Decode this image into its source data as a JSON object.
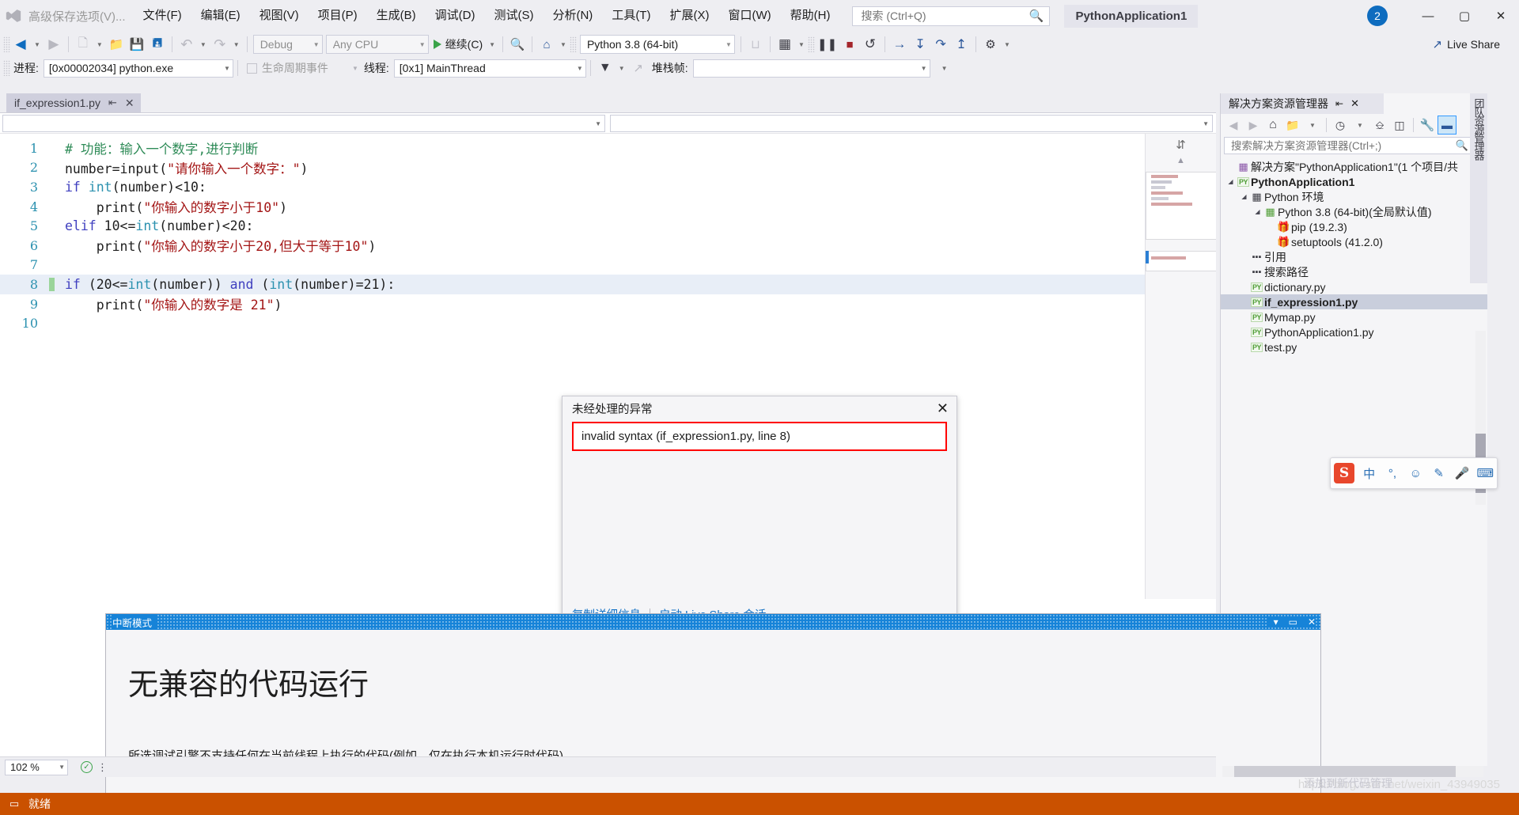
{
  "titlebar": {
    "quick_access_label": "高级保存选项(V)...",
    "menus": [
      {
        "label": "文件(F)"
      },
      {
        "label": "编辑(E)"
      },
      {
        "label": "视图(V)"
      },
      {
        "label": "项目(P)"
      },
      {
        "label": "生成(B)"
      },
      {
        "label": "调试(D)"
      },
      {
        "label": "测试(S)"
      },
      {
        "label": "分析(N)"
      },
      {
        "label": "工具(T)"
      },
      {
        "label": "扩展(X)"
      },
      {
        "label": "窗口(W)"
      },
      {
        "label": "帮助(H)"
      }
    ],
    "search_placeholder": "搜索 (Ctrl+Q)",
    "project_title": "PythonApplication1",
    "notification_count": "2",
    "window_minimize": "—",
    "window_maximize": "▢",
    "window_close": "✕"
  },
  "toolbar": {
    "back_label": "◀",
    "forward_label": "▶",
    "new_label": "▤",
    "open_label": "📂",
    "save_label": "💾",
    "save_all_label": "🖫",
    "undo_label": "↶",
    "redo_label": "↷",
    "config_value": "Debug",
    "platform_value": "Any CPU",
    "continue_label": "继续(C)",
    "attach_label": "🔍",
    "home_label": "⌂",
    "interpreter_value": "Python 3.8 (64-bit)",
    "layout_label": "▤",
    "pause_label": "❚❚",
    "stop_label": "■",
    "restart_label": "↺",
    "show_next_label": "→",
    "step_into_label": "↓",
    "step_over_label": "↷",
    "step_out_label": "↑",
    "hotreload_label": "⚡",
    "live_share_label": "Live Share"
  },
  "debugbar": {
    "process_label": "进程:",
    "process_value": "[0x00002034] python.exe",
    "lifecycle_label": "生命周期事件",
    "thread_label": "线程:",
    "thread_value": "[0x1] MainThread",
    "stack_label": "堆栈帧:",
    "stack_value": ""
  },
  "editor": {
    "tab_label": "if_expression1.py",
    "tab_pin": "⇤",
    "tab_close": "✕",
    "lines": [
      {
        "num": "1",
        "bp": false,
        "current": false,
        "tokens": [
          {
            "t": "# 功能：输入一个数字,进行判断",
            "c": "tok-com"
          }
        ]
      },
      {
        "num": "2",
        "bp": false,
        "current": false,
        "tokens": [
          {
            "t": "number=input(",
            "c": "tok-pl"
          },
          {
            "t": "\"请你输入一个数字：\"",
            "c": "tok-str"
          },
          {
            "t": ")",
            "c": "tok-pl"
          }
        ]
      },
      {
        "num": "3",
        "bp": false,
        "current": false,
        "tokens": [
          {
            "t": "if ",
            "c": "tok-kw"
          },
          {
            "t": "int",
            "c": "tok-fn"
          },
          {
            "t": "(number)<10:",
            "c": "tok-pl"
          }
        ]
      },
      {
        "num": "4",
        "bp": false,
        "current": false,
        "tokens": [
          {
            "t": "    print(",
            "c": "tok-pl"
          },
          {
            "t": "\"你输入的数字小于10\"",
            "c": "tok-str"
          },
          {
            "t": ")",
            "c": "tok-pl"
          }
        ]
      },
      {
        "num": "5",
        "bp": false,
        "current": false,
        "tokens": [
          {
            "t": "elif ",
            "c": "tok-kw"
          },
          {
            "t": "10<=",
            "c": "tok-pl"
          },
          {
            "t": "int",
            "c": "tok-fn"
          },
          {
            "t": "(number)<20:",
            "c": "tok-pl"
          }
        ]
      },
      {
        "num": "6",
        "bp": false,
        "current": false,
        "tokens": [
          {
            "t": "    print(",
            "c": "tok-pl"
          },
          {
            "t": "\"你输入的数字小于20,但大于等于10\"",
            "c": "tok-str"
          },
          {
            "t": ")",
            "c": "tok-pl"
          }
        ]
      },
      {
        "num": "7",
        "bp": false,
        "current": false,
        "tokens": [
          {
            "t": "",
            "c": "tok-pl"
          }
        ]
      },
      {
        "num": "8",
        "bp": true,
        "current": true,
        "tokens": [
          {
            "t": "if ",
            "c": "tok-kw"
          },
          {
            "t": "(20<=",
            "c": "tok-pl"
          },
          {
            "t": "int",
            "c": "tok-fn"
          },
          {
            "t": "(number)) ",
            "c": "tok-pl"
          },
          {
            "t": "and ",
            "c": "tok-kw"
          },
          {
            "t": "(",
            "c": "tok-pl"
          },
          {
            "t": "int",
            "c": "tok-fn"
          },
          {
            "t": "(number)=21):",
            "c": "tok-pl"
          }
        ]
      },
      {
        "num": "9",
        "bp": false,
        "current": false,
        "tokens": [
          {
            "t": "    print(",
            "c": "tok-pl"
          },
          {
            "t": "\"你输入的数字是 21\"",
            "c": "tok-str"
          },
          {
            "t": ")",
            "c": "tok-pl"
          }
        ]
      },
      {
        "num": "10",
        "bp": false,
        "current": false,
        "tokens": [
          {
            "t": "",
            "c": "tok-pl"
          }
        ]
      }
    ],
    "zoom_value": "102 %"
  },
  "exception": {
    "title": "未经处理的异常",
    "close": "✕",
    "message": "invalid syntax (if_expression1.py, line 8)",
    "copy_link": "复制详细信息",
    "liveshare_link": "启动 Live Share 会话...",
    "border_color": "#ff0000"
  },
  "solution_explorer": {
    "tab_label": "解决方案资源管理器",
    "tab_pin": "⇤",
    "tab_close": "✕",
    "dropdown": "▼",
    "vertical_tab": "团队资源管理器",
    "toolbar": {
      "back": "◌",
      "forward": "◌",
      "home": "⌂",
      "new_folder": "🗂",
      "caret": "▾",
      "pending": "◔",
      "caret2": "▾",
      "collapse": "⊐",
      "properties": "▣",
      "settings": "🔧",
      "preview": "▬"
    },
    "search_placeholder": "搜索解决方案资源管理器(Ctrl+;)",
    "tree": [
      {
        "indent": 0,
        "exp": "",
        "icon": "solution",
        "label": "解决方案\"PythonApplication1\"(1 个项目/共",
        "bold": false,
        "selected": false
      },
      {
        "indent": 0,
        "exp": "◢",
        "icon": "py",
        "label": "PythonApplication1",
        "bold": true,
        "selected": false
      },
      {
        "indent": 1,
        "exp": "◢",
        "icon": "env",
        "label": "Python 环境",
        "bold": false,
        "selected": false
      },
      {
        "indent": 2,
        "exp": "◢",
        "icon": "interp",
        "label": "Python 3.8 (64-bit)(全局默认值)",
        "bold": false,
        "selected": false
      },
      {
        "indent": 3,
        "exp": "",
        "icon": "pkg",
        "label": "pip (19.2.3)",
        "bold": false,
        "selected": false
      },
      {
        "indent": 3,
        "exp": "",
        "icon": "pkg",
        "label": "setuptools (41.2.0)",
        "bold": false,
        "selected": false
      },
      {
        "indent": 1,
        "exp": "",
        "icon": "ref",
        "label": "引用",
        "bold": false,
        "selected": false
      },
      {
        "indent": 1,
        "exp": "",
        "icon": "ref",
        "label": "搜索路径",
        "bold": false,
        "selected": false
      },
      {
        "indent": 1,
        "exp": "",
        "icon": "py",
        "label": "dictionary.py",
        "bold": false,
        "selected": false
      },
      {
        "indent": 1,
        "exp": "",
        "icon": "py",
        "label": "if_expression1.py",
        "bold": true,
        "selected": true
      },
      {
        "indent": 1,
        "exp": "",
        "icon": "py",
        "label": "Mymap.py",
        "bold": false,
        "selected": false
      },
      {
        "indent": 1,
        "exp": "",
        "icon": "py",
        "label": "PythonApplication1.py",
        "bold": false,
        "selected": false
      },
      {
        "indent": 1,
        "exp": "",
        "icon": "py",
        "label": "test.py",
        "bold": false,
        "selected": false
      }
    ]
  },
  "ime_bar": {
    "logo": "S",
    "mode": "中",
    "punct": "°,",
    "emoji": "☺",
    "pen": "✎",
    "mic": "🎤",
    "keyboard": "⌨"
  },
  "break_window": {
    "title": "中断模式",
    "minimize": "▾",
    "maximize": "▭",
    "close": "✕",
    "heading": "无兼容的代码运行",
    "body": "所选调试引擎不支持任何在当前线程上执行的代码(例如，仅在执行本机运行时代码)。"
  },
  "statusbar": {
    "icon": "▭",
    "text": "就绪"
  },
  "watermark": {
    "url": "https://blog.csdn.net/weixin_43949035",
    "extra": "添加到新代码管理"
  },
  "colors": {
    "accent_blue": "#1683d8",
    "status_orange": "#ca5100",
    "error_red": "#ff0000",
    "keyword_blue": "#3f3fbf",
    "string_red": "#a31515",
    "comment_green": "#2e8b57",
    "type_teal": "#2b91af"
  }
}
